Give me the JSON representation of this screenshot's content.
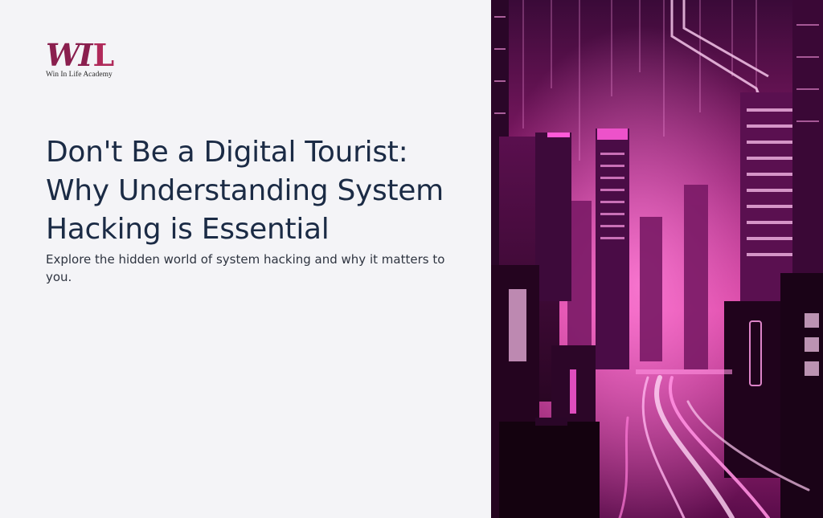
{
  "logo": {
    "mark_wi": "WI",
    "mark_l": "L",
    "tagline": "Win In Life Academy"
  },
  "slide": {
    "title": "Don't Be a Digital Tourist: Why Understanding System Hacking is Essential",
    "subtitle": "Explore the hidden world of system hacking and why it matters to you."
  },
  "image": {
    "icon": "cyberpunk-city-image",
    "accent": "#ff3fd0",
    "base": "#2a0828"
  }
}
